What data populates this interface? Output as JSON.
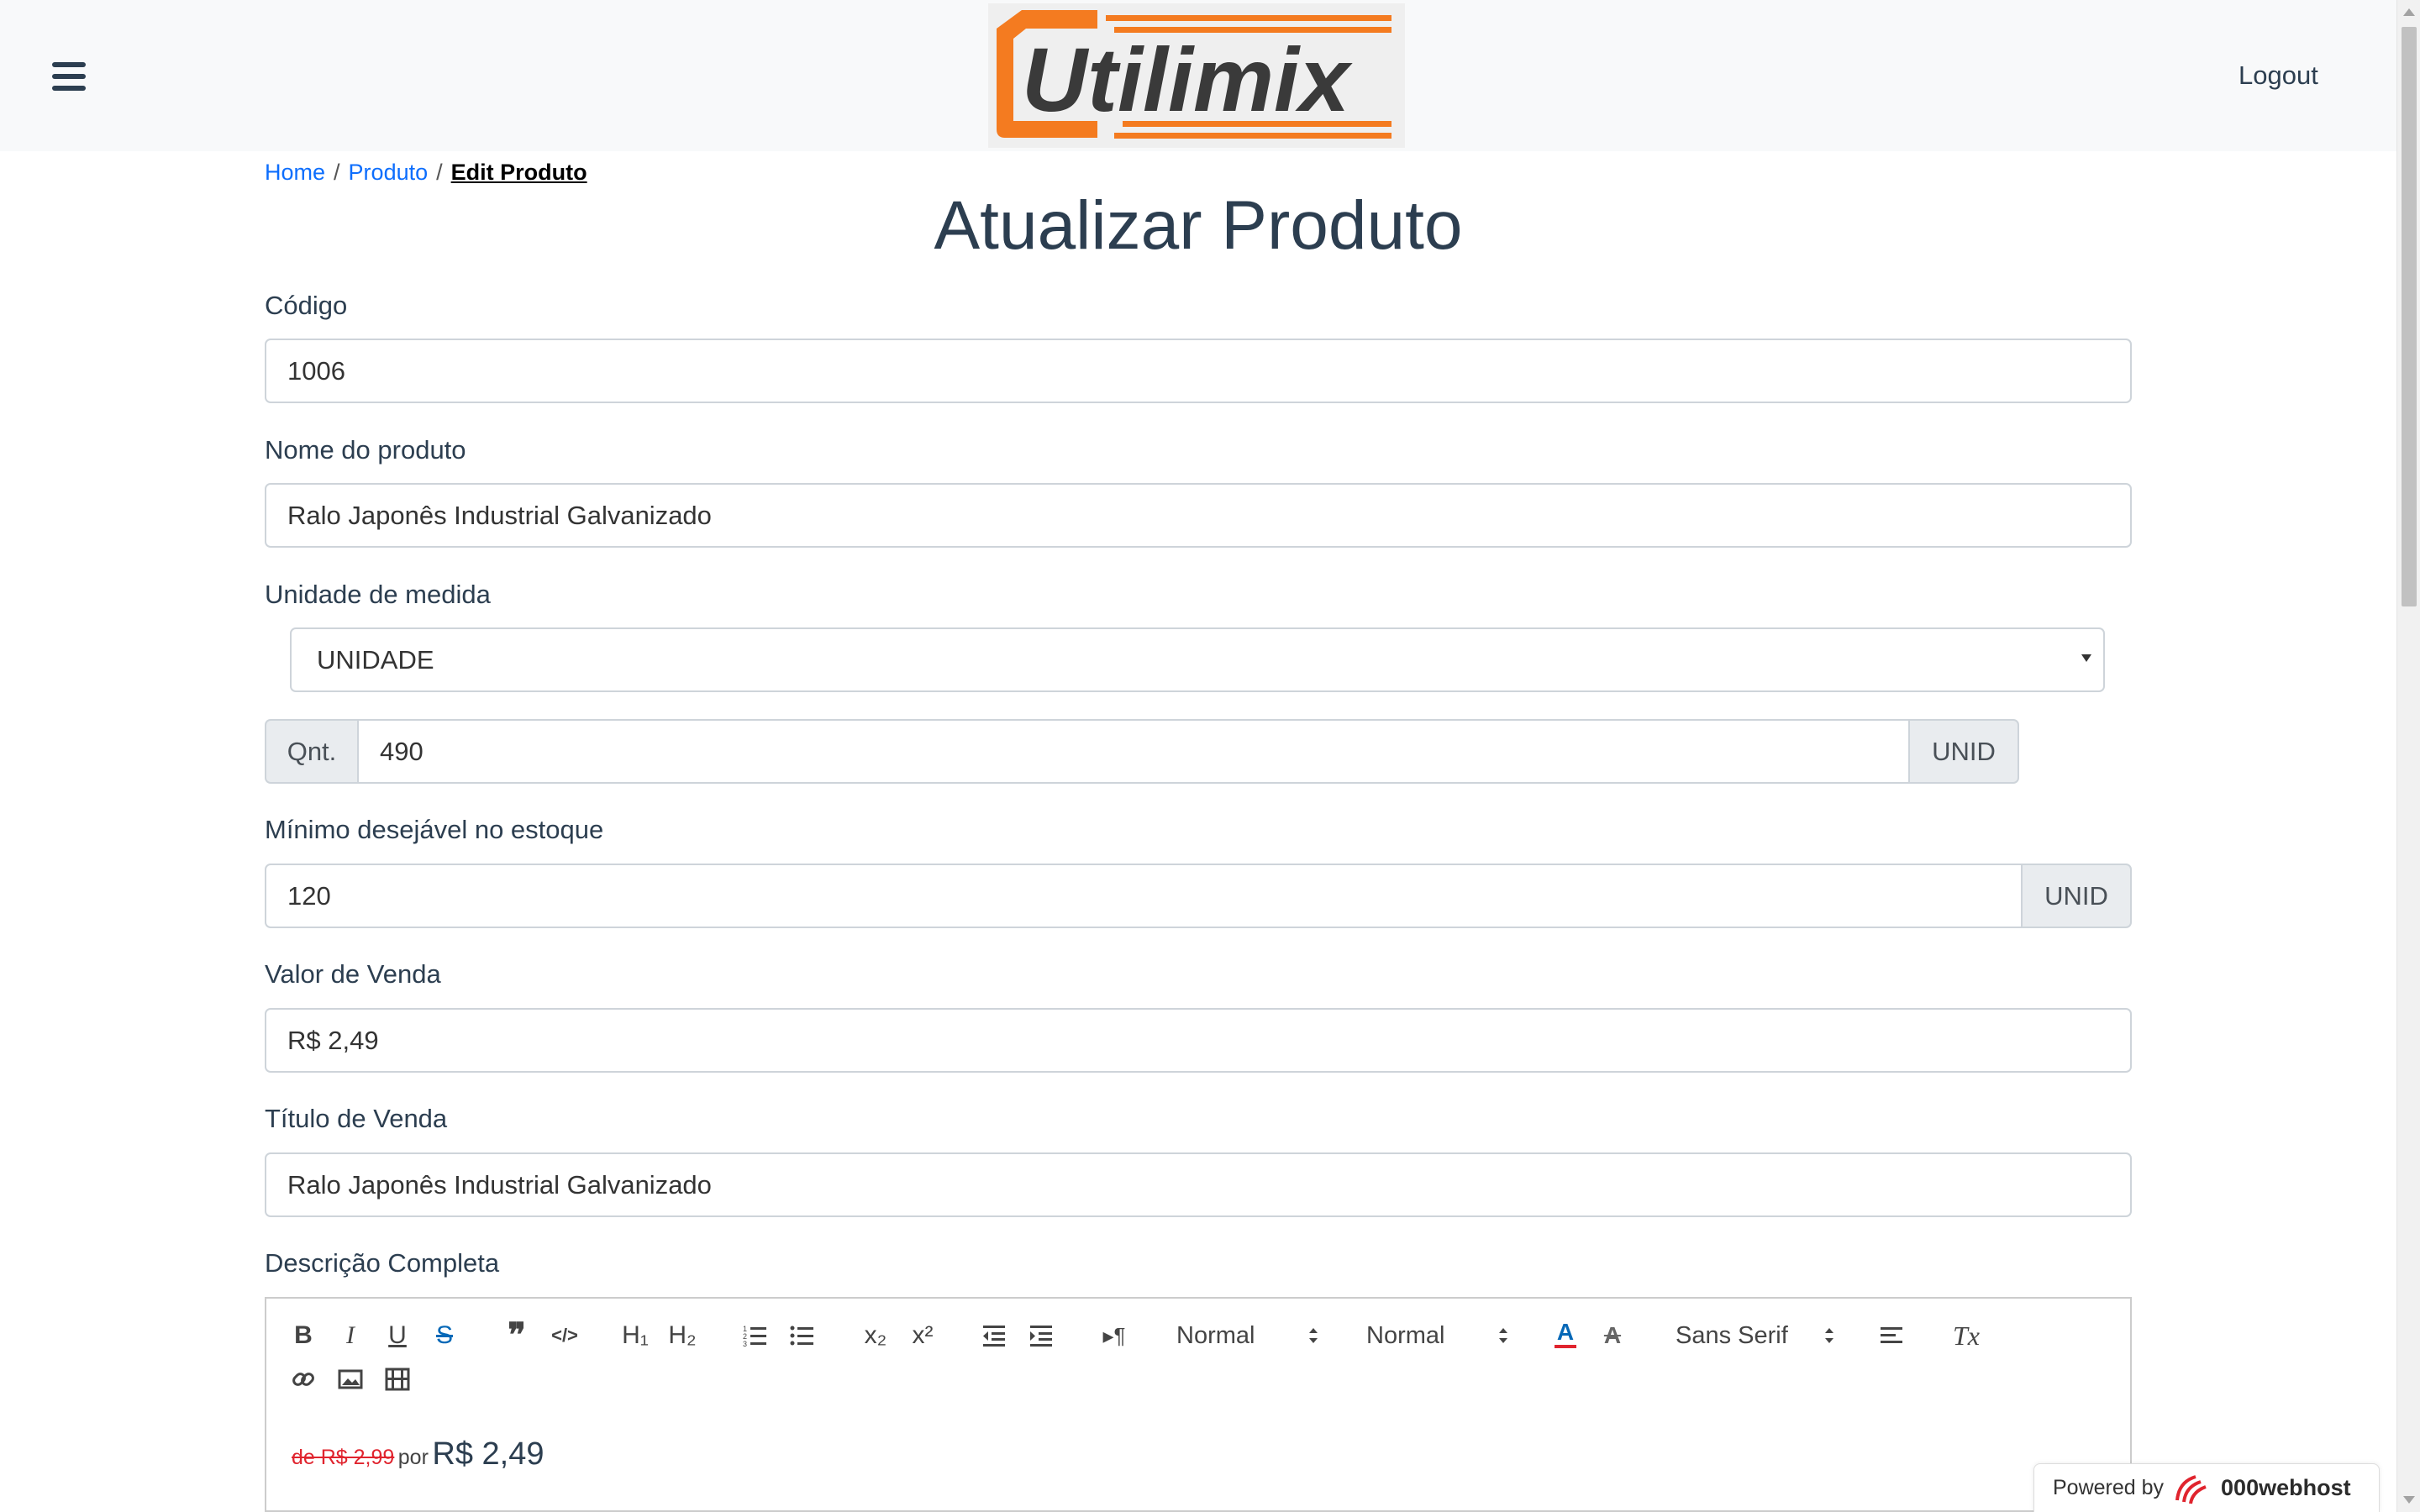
{
  "header": {
    "logo_text": "Utilimix",
    "logout_label": "Logout"
  },
  "breadcrumb": {
    "home": "Home",
    "sep1": "/",
    "produto": "Produto",
    "sep2": "/",
    "current": "Edit Produto"
  },
  "page": {
    "title": "Atualizar Produto"
  },
  "form": {
    "codigo": {
      "label": "Código",
      "value": "1006"
    },
    "nome": {
      "label": "Nome do produto",
      "value": "Ralo Japonês Industrial Galvanizado"
    },
    "unidade": {
      "label": "Unidade de medida",
      "selected": "UNIDADE"
    },
    "quantidade": {
      "prefix": "Qnt.",
      "value": "490",
      "suffix": "UNID"
    },
    "minimo": {
      "label": "Mínimo desejável no estoque",
      "value": "120",
      "suffix": "UNID"
    },
    "valor": {
      "label": "Valor de Venda",
      "value": "R$ 2,49"
    },
    "titulo": {
      "label": "Título de Venda",
      "value": "Ralo Japonês Industrial Galvanizado"
    },
    "descricao": {
      "label": "Descrição Completa",
      "toolbar": {
        "bold": "B",
        "italic": "I",
        "underline": "U",
        "strike": "S",
        "quote": "❞",
        "code": "</>",
        "h1": "H₁",
        "h2": "H₂",
        "sub": "x₂",
        "sup": "x²",
        "direction": "▸¶",
        "size_picker": "Normal",
        "header_picker": "Normal",
        "font_picker": "Sans Serif",
        "color": "A",
        "background": "A",
        "clean": "Tx"
      },
      "content": {
        "old_price": "de R$ 2,99",
        "por": "por",
        "new_price": "R$ 2,49"
      }
    }
  },
  "footer": {
    "powered_by": "Powered by",
    "host_brand": "000webhost"
  },
  "colors": {
    "navbar": "#f8f9fa",
    "link": "#0d6efd",
    "text": "#2c3e50",
    "old_price": "#e0242e",
    "logo_orange": "#f47b20",
    "logo_dark": "#3a3a3a"
  },
  "icons": [
    "menu-icon",
    "link-icon",
    "image-icon",
    "video-icon",
    "ordered-list-icon",
    "bullet-list-icon",
    "outdent-icon",
    "indent-icon",
    "align-icon",
    "000webhost-logo-icon"
  ]
}
